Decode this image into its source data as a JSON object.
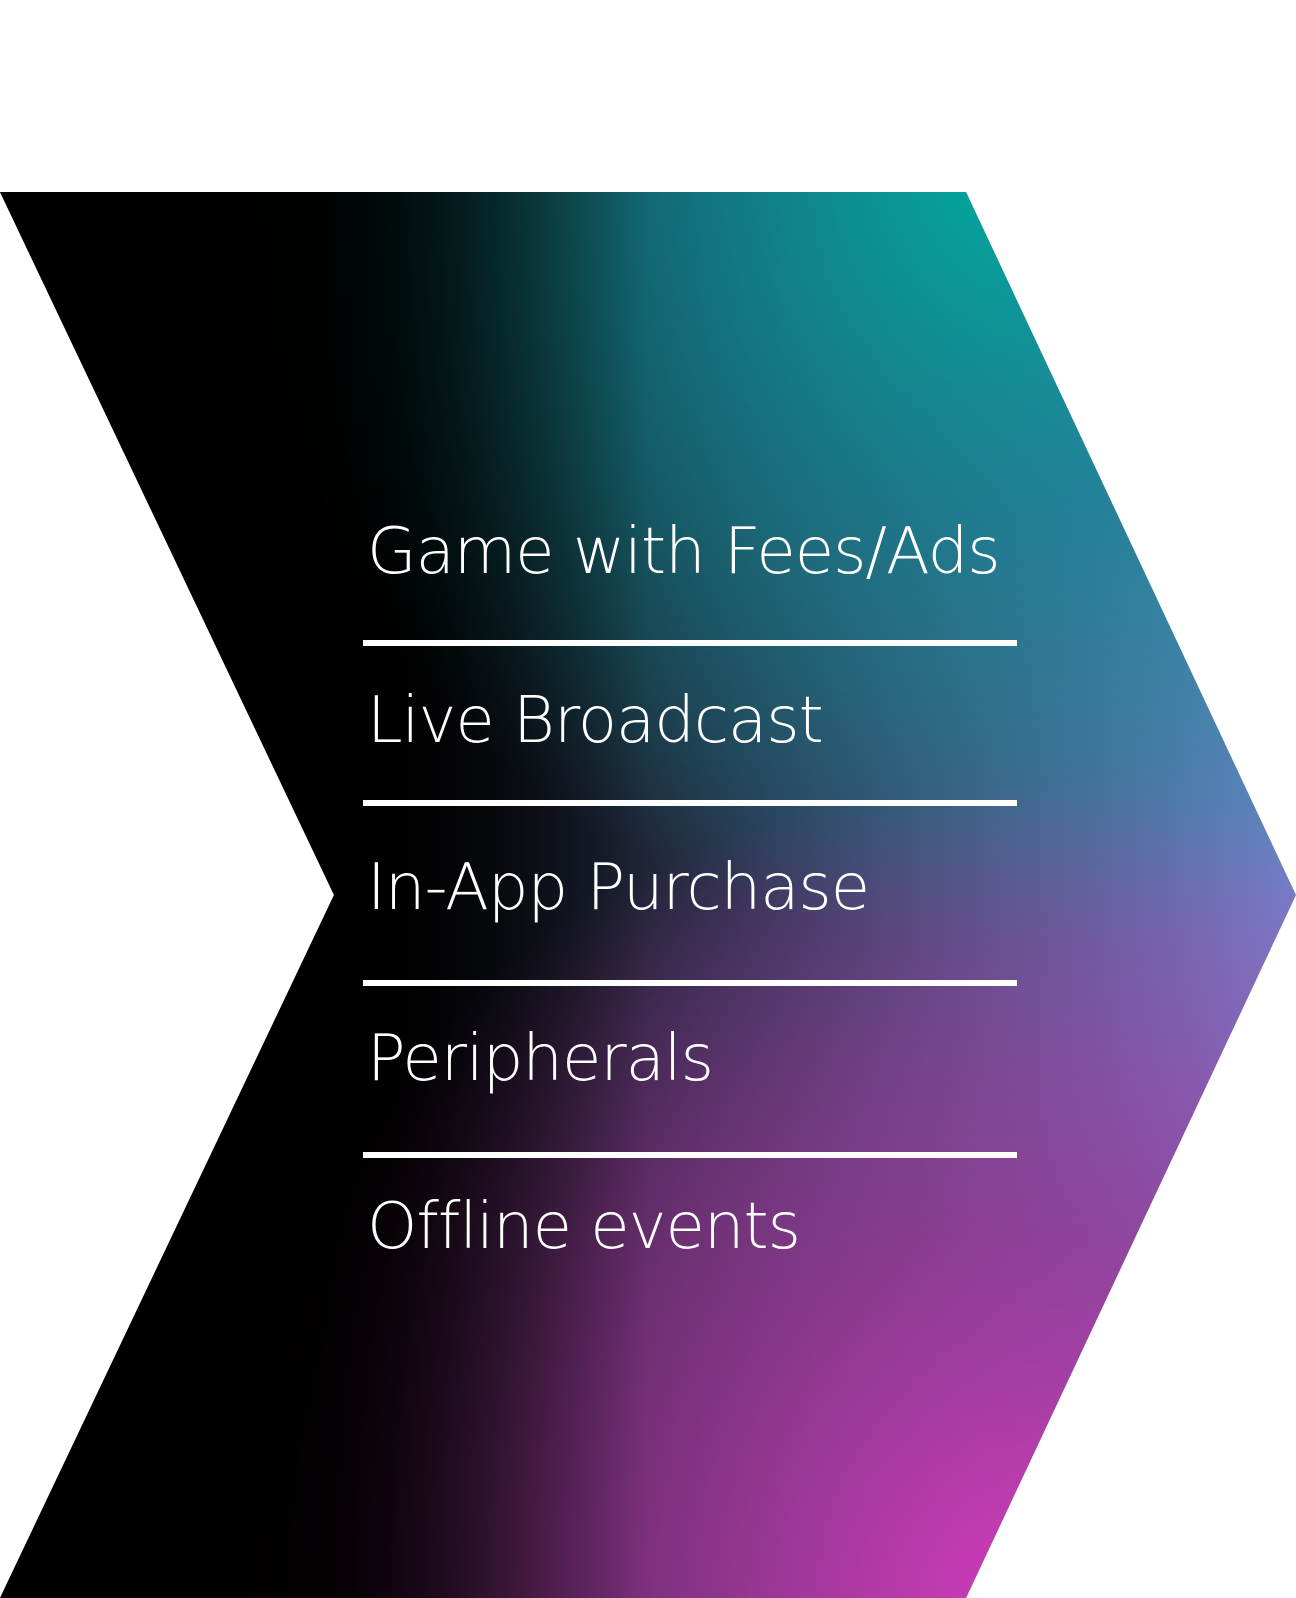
{
  "items": [
    {
      "label": "Game with Fees/Ads"
    },
    {
      "label": "Live Broadcast"
    },
    {
      "label": "In-App Purchase"
    },
    {
      "label": "Peripherals"
    },
    {
      "label": "Offline events"
    }
  ],
  "colors": {
    "background": "#ffffff",
    "text": "#ffffff",
    "divider": "#ffffff",
    "gradient_dark": "#000000",
    "gradient_teal": "#00a99d",
    "gradient_blue": "#6f82c8",
    "gradient_magenta": "#d23aba"
  }
}
